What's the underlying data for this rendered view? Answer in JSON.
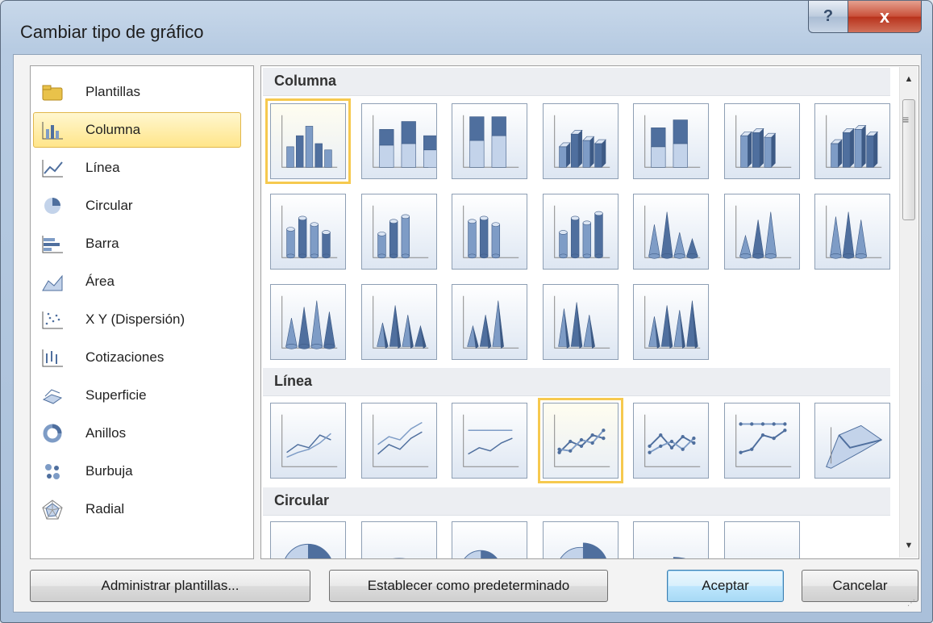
{
  "window": {
    "title": "Cambiar tipo de gráfico",
    "help_label": "?",
    "close_label": "x"
  },
  "chart_types": [
    {
      "label": "Plantillas",
      "icon": "folder-icon",
      "selected": false
    },
    {
      "label": "Columna",
      "icon": "column-chart-icon",
      "selected": true
    },
    {
      "label": "Línea",
      "icon": "line-chart-icon",
      "selected": false
    },
    {
      "label": "Circular",
      "icon": "pie-chart-icon",
      "selected": false
    },
    {
      "label": "Barra",
      "icon": "bar-chart-icon",
      "selected": false
    },
    {
      "label": "Área",
      "icon": "area-chart-icon",
      "selected": false
    },
    {
      "label": "X Y (Dispersión)",
      "icon": "scatter-chart-icon",
      "selected": false
    },
    {
      "label": "Cotizaciones",
      "icon": "stock-chart-icon",
      "selected": false
    },
    {
      "label": "Superficie",
      "icon": "surface-chart-icon",
      "selected": false
    },
    {
      "label": "Anillos",
      "icon": "doughnut-chart-icon",
      "selected": false
    },
    {
      "label": "Burbuja",
      "icon": "bubble-chart-icon",
      "selected": false
    },
    {
      "label": "Radial",
      "icon": "radar-chart-icon",
      "selected": false
    }
  ],
  "gallery": {
    "sections": [
      {
        "title": "Columna",
        "thumbnails": 19,
        "selected_index": 0
      },
      {
        "title": "Línea",
        "thumbnails": 7,
        "selected_index": 3
      },
      {
        "title": "Circular",
        "thumbnails": 6,
        "selected_index": -1
      }
    ]
  },
  "buttons": {
    "manage_templates": "Administrar plantillas...",
    "set_default": "Establecer como predeterminado",
    "ok": "Aceptar",
    "cancel": "Cancelar"
  },
  "colors": {
    "accent_blue": "#4f6f9e",
    "selection_yellow": "#ffe58a",
    "close_red": "#c95039"
  }
}
